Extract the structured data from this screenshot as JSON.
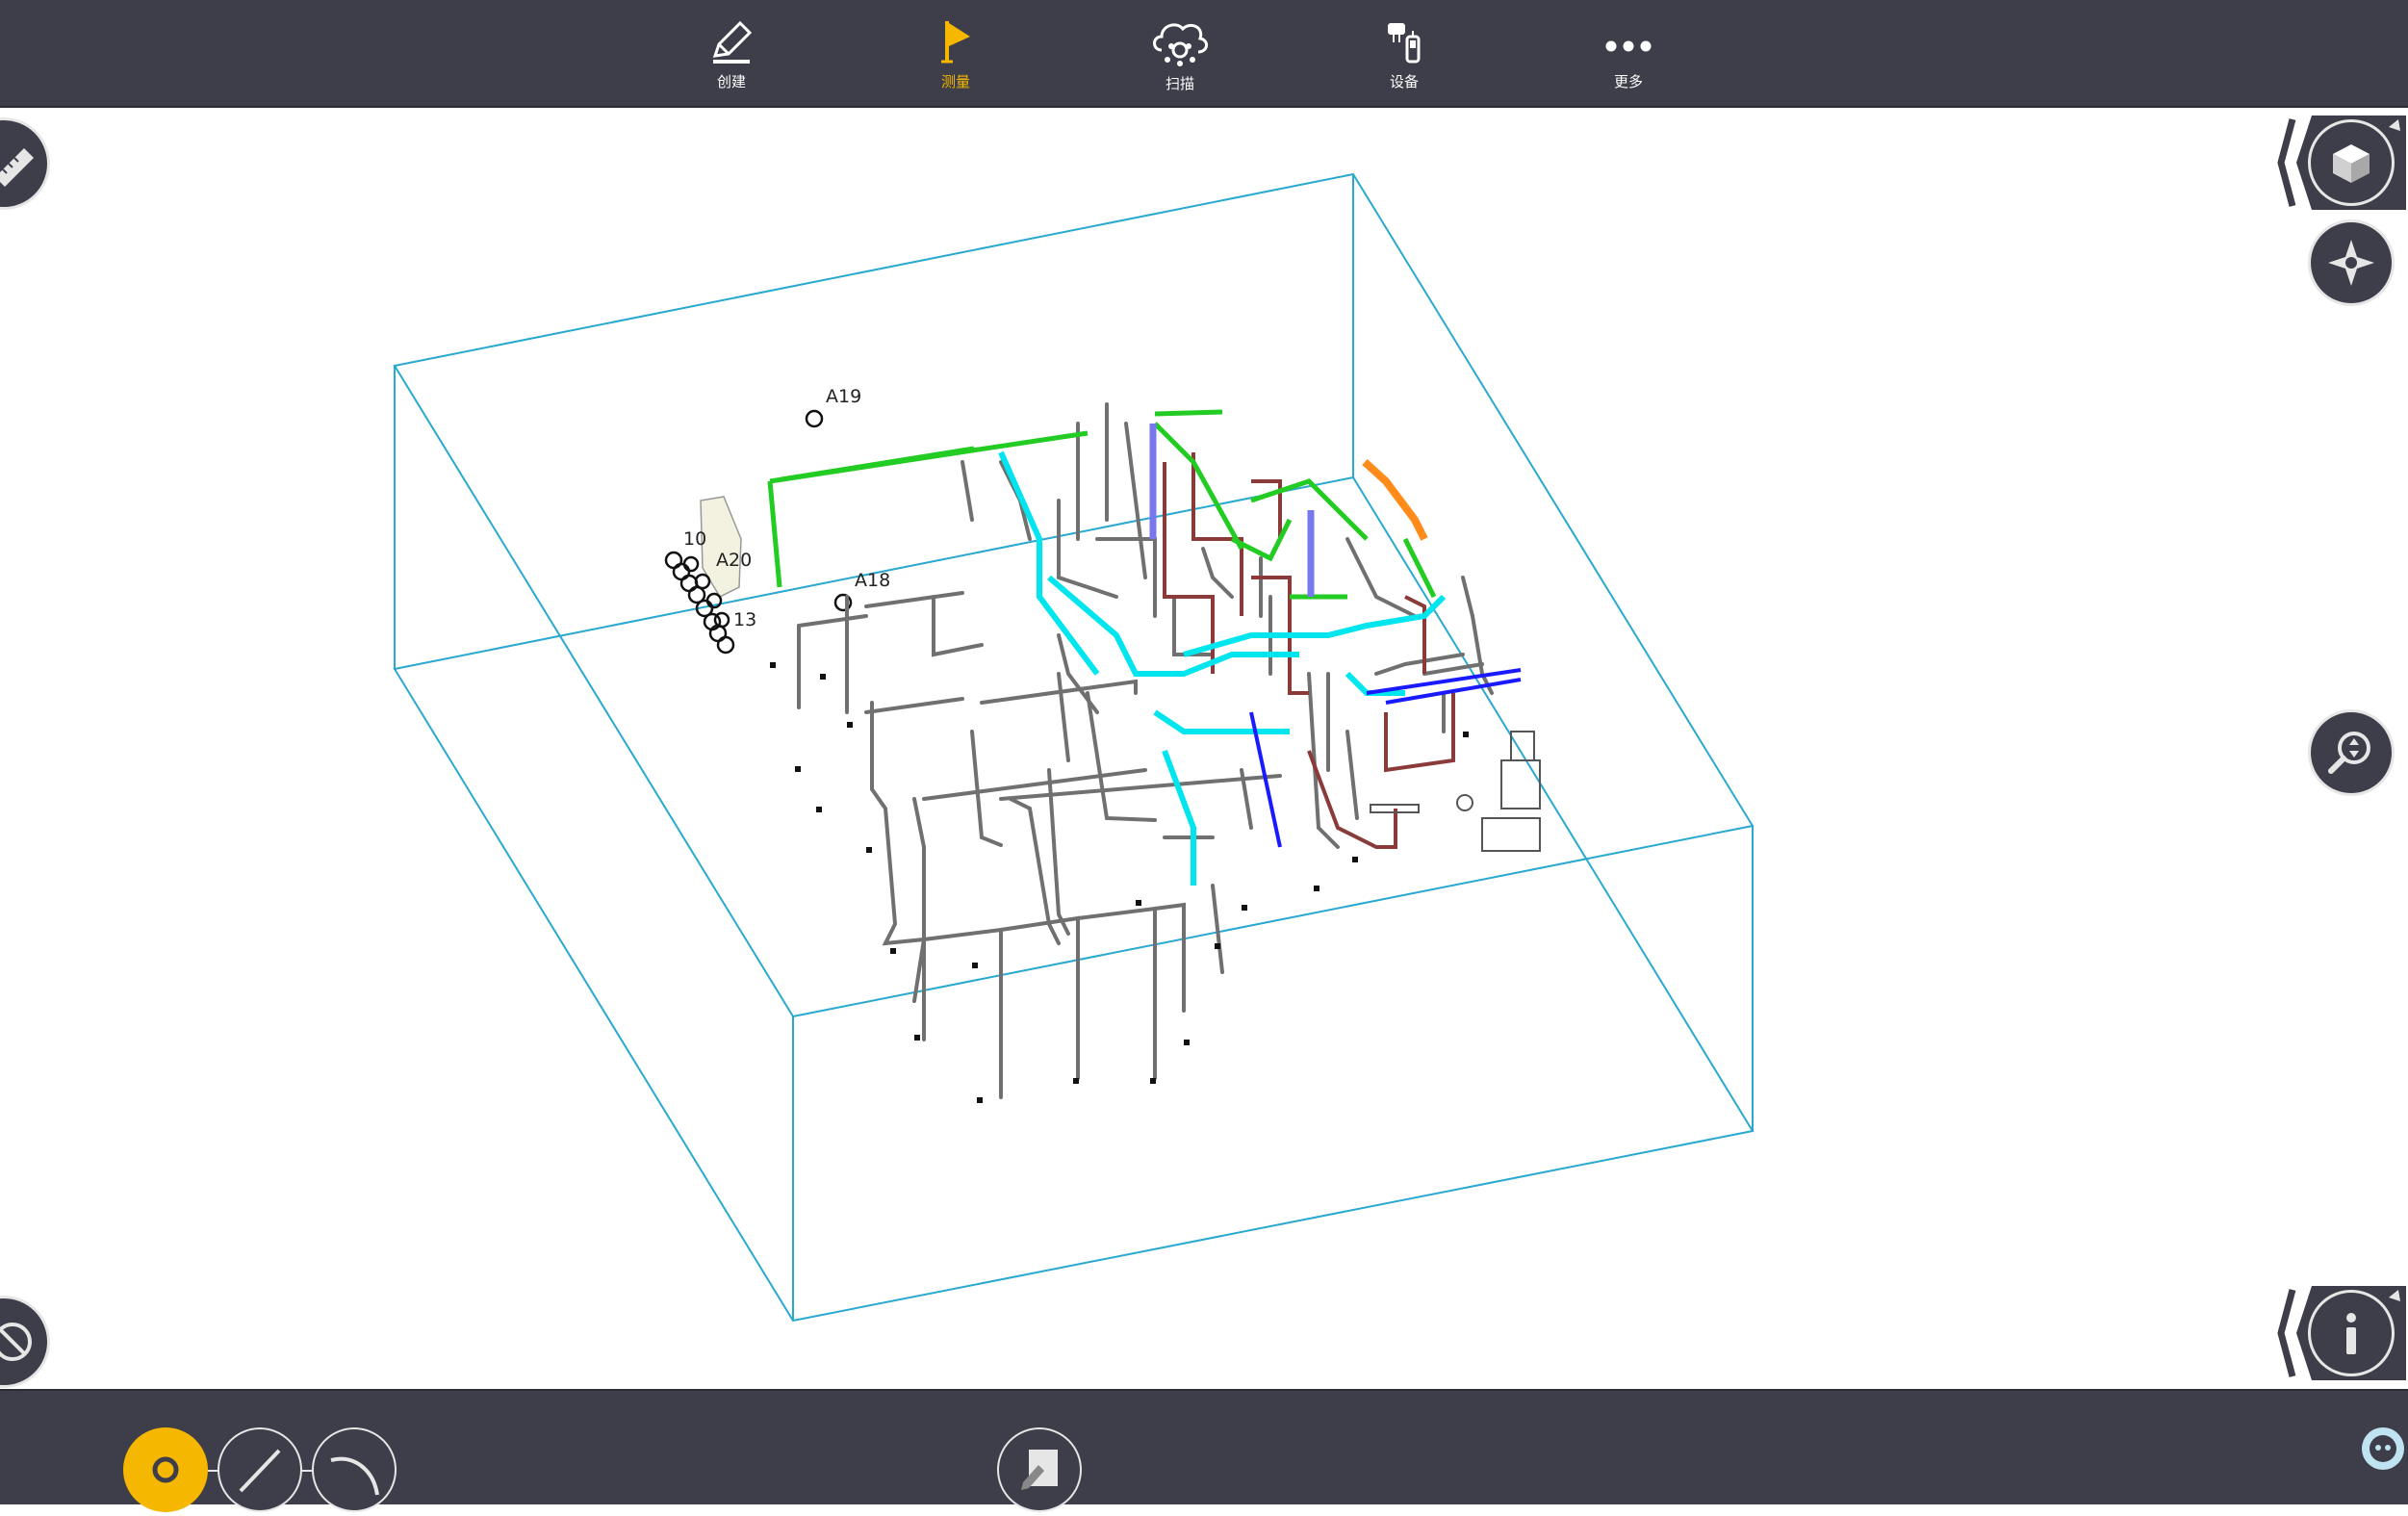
{
  "toolbar": {
    "items": [
      {
        "label": "创建",
        "icon": "pencil-icon",
        "active": false
      },
      {
        "label": "测量",
        "icon": "flag-icon",
        "active": true
      },
      {
        "label": "扫描",
        "icon": "scan-cloud-icon",
        "active": false
      },
      {
        "label": "设备",
        "icon": "devices-icon",
        "active": false
      },
      {
        "label": "更多",
        "icon": "more-dots-icon",
        "active": false
      }
    ],
    "active_color": "#f5b700",
    "background": "#3d3e49"
  },
  "model": {
    "box_color": "#29a9cf",
    "labels": {
      "a19": "A19",
      "a20": "A20",
      "a18": "A18",
      "n10": "10",
      "n13": "13"
    },
    "pipe_colors": [
      "#6e6e6e",
      "#8b3a3a",
      "#22cc22",
      "#00e5ee",
      "#1a1aff",
      "#ff8c1a",
      "#7777ee"
    ]
  },
  "side_controls": {
    "left": [
      "ruler-icon",
      "no-entry-icon"
    ],
    "right": [
      "cube-view-icon",
      "orbit-icon",
      "zoom-icon",
      "info-icon"
    ]
  },
  "bottom_bar": {
    "point_tool": "point-tool-icon",
    "line_tool": "line-tool-icon",
    "arc_tool": "arc-tool-icon",
    "edit_tool": "edit-note-icon",
    "chat": "chat-icon"
  }
}
